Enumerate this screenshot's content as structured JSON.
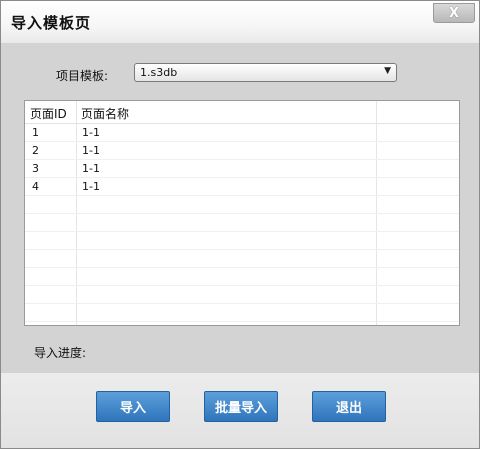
{
  "window": {
    "title": "导入模板页",
    "close_glyph": "X"
  },
  "form": {
    "template_label": "项目模板:",
    "template_value": "1.s3db",
    "progress_label": "导入进度:"
  },
  "table": {
    "columns": [
      "页面ID",
      "页面名称"
    ],
    "rows": [
      {
        "id": "1",
        "name": "1-1"
      },
      {
        "id": "2",
        "name": "1-1"
      },
      {
        "id": "3",
        "name": "1-1"
      },
      {
        "id": "4",
        "name": "1-1"
      }
    ]
  },
  "buttons": {
    "import": "导入",
    "batch_import": "批量导入",
    "exit": "退出"
  },
  "icons": {
    "close": "close-icon",
    "dropdown": "chevron-down-icon"
  },
  "colors": {
    "button_blue": "#3a82c9",
    "panel_gray": "#d3d3d3"
  }
}
